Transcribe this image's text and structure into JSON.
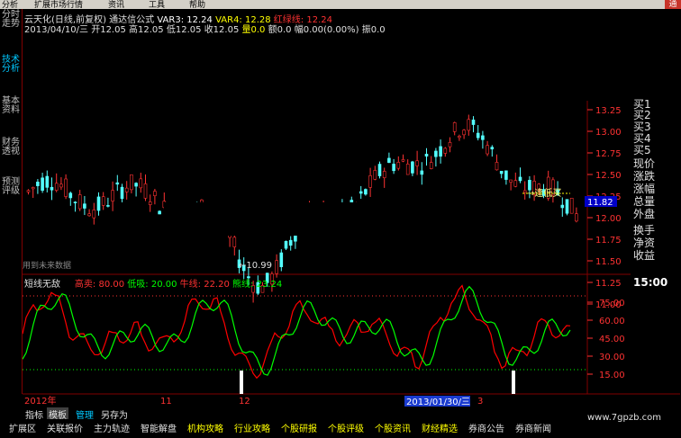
{
  "menubar": {
    "items": [
      "分析",
      "扩展市场行情",
      "资讯",
      "工具",
      "帮助"
    ],
    "close_label": "通"
  },
  "left_tabs": [
    {
      "label": "分时走势",
      "active": false
    },
    {
      "label": "技术分析",
      "active": true
    },
    {
      "label": "基本资料",
      "active": false
    },
    {
      "label": "财务透视",
      "active": false
    },
    {
      "label": "预测评级",
      "active": false
    }
  ],
  "header": {
    "stock": "云天化(日线,前复权)",
    "formula": "通达信公式",
    "var3": "VAR3: 12.24",
    "var4": "VAR4: 12.28",
    "red_green": "红绿线: 12.24",
    "date": "2013/04/10/三",
    "open": "开12.05",
    "high": "高12.05",
    "low": "低12.05",
    "close": "收12.05",
    "volume": "量0.0",
    "amount": "额0.0",
    "change": "幅0.00(0.00%)",
    "amplitude": "振0.0"
  },
  "indicator": {
    "name": "短线无敌",
    "sell_label": "高卖: 80.00",
    "low_label": "低吸: 20.00",
    "bull_label": "牛线: 22.20",
    "bear_label": "熊线: 23.24"
  },
  "price_axis": {
    "ticks": [
      "13.25",
      "13.00",
      "12.75",
      "12.50",
      "12.25",
      "12.00",
      "11.75",
      "11.50",
      "11.25",
      "11.00"
    ],
    "current": "11.82"
  },
  "indicator_axis": {
    "ticks": [
      "75.00",
      "60.00",
      "45.00",
      "30.00",
      "15.00"
    ]
  },
  "annotations": {
    "low_price": "←10.99",
    "future_data": "用到未来数据",
    "signal": "→逢低买"
  },
  "time_axis": {
    "labels": [
      "2012年",
      "11",
      "12",
      "3"
    ],
    "cursor_date": "2013/01/30/三"
  },
  "right_panel": {
    "items": [
      "买1",
      "买2",
      "买3",
      "买4",
      "买5",
      "现价",
      "涨跌",
      "涨幅",
      "总量",
      "外盘",
      "换手",
      "净资",
      "收益"
    ],
    "time": "15:00"
  },
  "tabs": [
    "指标",
    "模板",
    "管理",
    "另存为"
  ],
  "bottom_nav": [
    "扩展区",
    "关联报价",
    "主力轨迹",
    "智能解盘",
    "机构攻略",
    "行业攻略",
    "个股研报",
    "个股评级",
    "个股资讯",
    "财经精选",
    "券商公告",
    "券商新闻"
  ],
  "watermark": "www.7gpzb.com",
  "colors": {
    "up": "#ff3232",
    "down": "#54ffff",
    "green_line": "#00ff00",
    "red_line": "#ff0000",
    "border": "#800000",
    "yellow": "#ffff00",
    "magenta": "#ff00ff"
  }
}
